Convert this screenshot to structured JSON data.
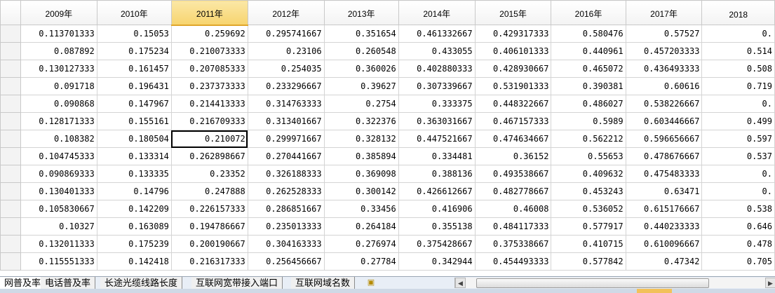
{
  "columns": [
    "",
    "2009年",
    "2010年",
    "2011年",
    "2012年",
    "2013年",
    "2014年",
    "2015年",
    "2016年",
    "2017年",
    "2018"
  ],
  "rows": [
    [
      "0.113701333",
      "0.15053",
      "0.259692",
      "0.295741667",
      "0.351654",
      "0.461332667",
      "0.429317333",
      "0.580476",
      "0.57527",
      "0."
    ],
    [
      "0.087892",
      "0.175234",
      "0.210073333",
      "0.23106",
      "0.260548",
      "0.433055",
      "0.406101333",
      "0.440961",
      "0.457203333",
      "0.514"
    ],
    [
      "0.130127333",
      "0.161457",
      "0.207085333",
      "0.254035",
      "0.360026",
      "0.402880333",
      "0.428930667",
      "0.465072",
      "0.436493333",
      "0.508"
    ],
    [
      "0.091718",
      "0.196431",
      "0.237373333",
      "0.233296667",
      "0.39627",
      "0.307339667",
      "0.531901333",
      "0.390381",
      "0.60616",
      "0.719"
    ],
    [
      "0.090868",
      "0.147967",
      "0.214413333",
      "0.314763333",
      "0.2754",
      "0.333375",
      "0.448322667",
      "0.486027",
      "0.538226667",
      "0."
    ],
    [
      "0.128171333",
      "0.155161",
      "0.216709333",
      "0.313401667",
      "0.322376",
      "0.363031667",
      "0.467157333",
      "0.5989",
      "0.603446667",
      "0.499"
    ],
    [
      "0.108382",
      "0.180504",
      "0.210072",
      "0.299971667",
      "0.328132",
      "0.447521667",
      "0.474634667",
      "0.562212",
      "0.596656667",
      "0.597"
    ],
    [
      "0.104745333",
      "0.133314",
      "0.262898667",
      "0.270441667",
      "0.385894",
      "0.334481",
      "0.36152",
      "0.55653",
      "0.478676667",
      "0.537"
    ],
    [
      "0.090869333",
      "0.133335",
      "0.23352",
      "0.326188333",
      "0.369098",
      "0.388136",
      "0.493538667",
      "0.409632",
      "0.475483333",
      "0."
    ],
    [
      "0.130401333",
      "0.14796",
      "0.247888",
      "0.262528333",
      "0.300142",
      "0.426612667",
      "0.482778667",
      "0.453243",
      "0.63471",
      "0."
    ],
    [
      "0.105830667",
      "0.142209",
      "0.226157333",
      "0.286851667",
      "0.33456",
      "0.416906",
      "0.46008",
      "0.536052",
      "0.615176667",
      "0.538"
    ],
    [
      "0.10327",
      "0.163089",
      "0.194786667",
      "0.235013333",
      "0.264184",
      "0.355138",
      "0.484117333",
      "0.577917",
      "0.440233333",
      "0.646"
    ],
    [
      "0.132011333",
      "0.175239",
      "0.200190667",
      "0.304163333",
      "0.276974",
      "0.375428667",
      "0.375338667",
      "0.410715",
      "0.610096667",
      "0.478"
    ],
    [
      "0.115551333",
      "0.142418",
      "0.216317333",
      "0.256456667",
      "0.27784",
      "0.342944",
      "0.454493333",
      "0.577842",
      "0.47342",
      "0.705"
    ]
  ],
  "active_cell": {
    "row": 6,
    "col": 2
  },
  "sheet_tabs": [
    "网普及率",
    "电话普及率",
    "长途光缆线路长度",
    "互联网宽带接入端口",
    "互联网域名数"
  ],
  "icons": {
    "new_sheet": "new-sheet-icon",
    "scroll_left": "scroll-left-icon",
    "scroll_right": "scroll-right-icon"
  },
  "colors": {
    "selected_header": "#f7d46e",
    "grid_line": "#d4d4d4",
    "tab_bar": "#e8eef6"
  }
}
